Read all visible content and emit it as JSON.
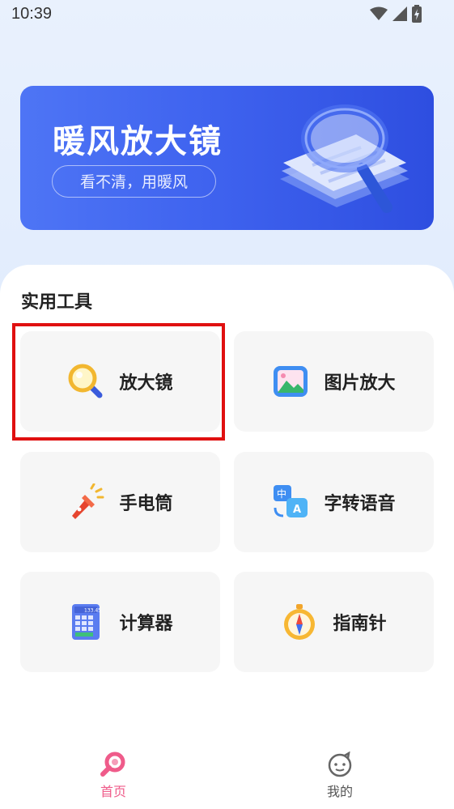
{
  "status_bar": {
    "time": "10:39"
  },
  "banner": {
    "title": "暖风放大镜",
    "subtitle": "看不清，用暖风"
  },
  "section": {
    "title": "实用工具"
  },
  "tools": [
    {
      "label": "放大镜",
      "icon": "magnifier-icon"
    },
    {
      "label": "图片放大",
      "icon": "picture-icon"
    },
    {
      "label": "手电筒",
      "icon": "flashlight-icon"
    },
    {
      "label": "字转语音",
      "icon": "translate-icon"
    },
    {
      "label": "计算器",
      "icon": "calculator-icon"
    },
    {
      "label": "指南针",
      "icon": "compass-icon"
    }
  ],
  "calculator_display": "133.45",
  "nav": {
    "home_label": "首页",
    "mine_label": "我的",
    "active_color": "#ef5b8a",
    "inactive_color": "#555555"
  },
  "colors": {
    "banner_start": "#4e75f5",
    "banner_end": "#2e4ee0",
    "highlight": "#e01010",
    "card_bg": "#f6f6f6"
  }
}
